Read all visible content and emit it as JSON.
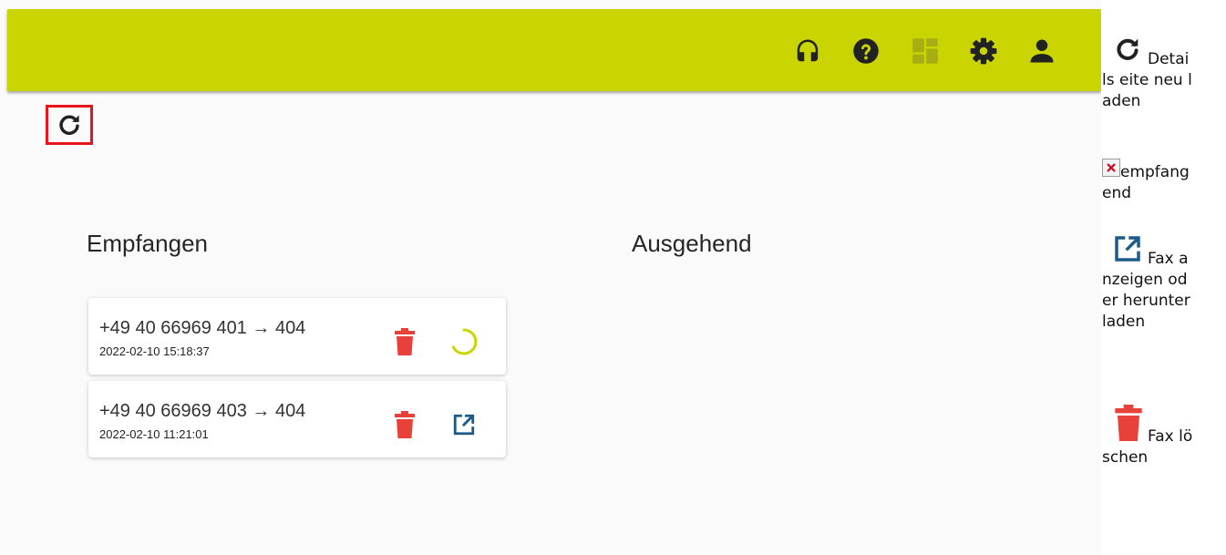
{
  "colors": {
    "topbar": "#cad400",
    "icon_dark": "#222222",
    "delete_red": "#e8413a",
    "spinner_yellow": "#cad400",
    "open_blue": "#1c5a8a",
    "highlight_red": "#e8141c"
  },
  "topbar": {
    "icons": [
      "headset-icon",
      "help-icon",
      "dashboard-icon",
      "settings-icon",
      "user-icon"
    ]
  },
  "toolbar": {
    "reload_icon": "reload-icon"
  },
  "received": {
    "title": "Empfangen",
    "faxes": [
      {
        "route": "+49 40 66969 401 → 404",
        "timestamp": "2022-02-10 15:18:37",
        "action": "loading-spinner-icon"
      },
      {
        "route": "+49 40 66969 403 → 404",
        "timestamp": "2022-02-10 11:21:01",
        "action": "open-external-icon"
      }
    ]
  },
  "outgoing": {
    "title": "Ausgehend"
  },
  "legend": {
    "reload": {
      "icon": "reload-icon",
      "text": "Details eite neu laden"
    },
    "received": {
      "icon": "broken-image-icon",
      "text": "empfangend"
    },
    "open": {
      "icon": "open-external-icon",
      "text": "Fax anzeigen oder herunterladen"
    },
    "delete": {
      "icon": "trash-icon",
      "text": "Fax löschen"
    }
  }
}
